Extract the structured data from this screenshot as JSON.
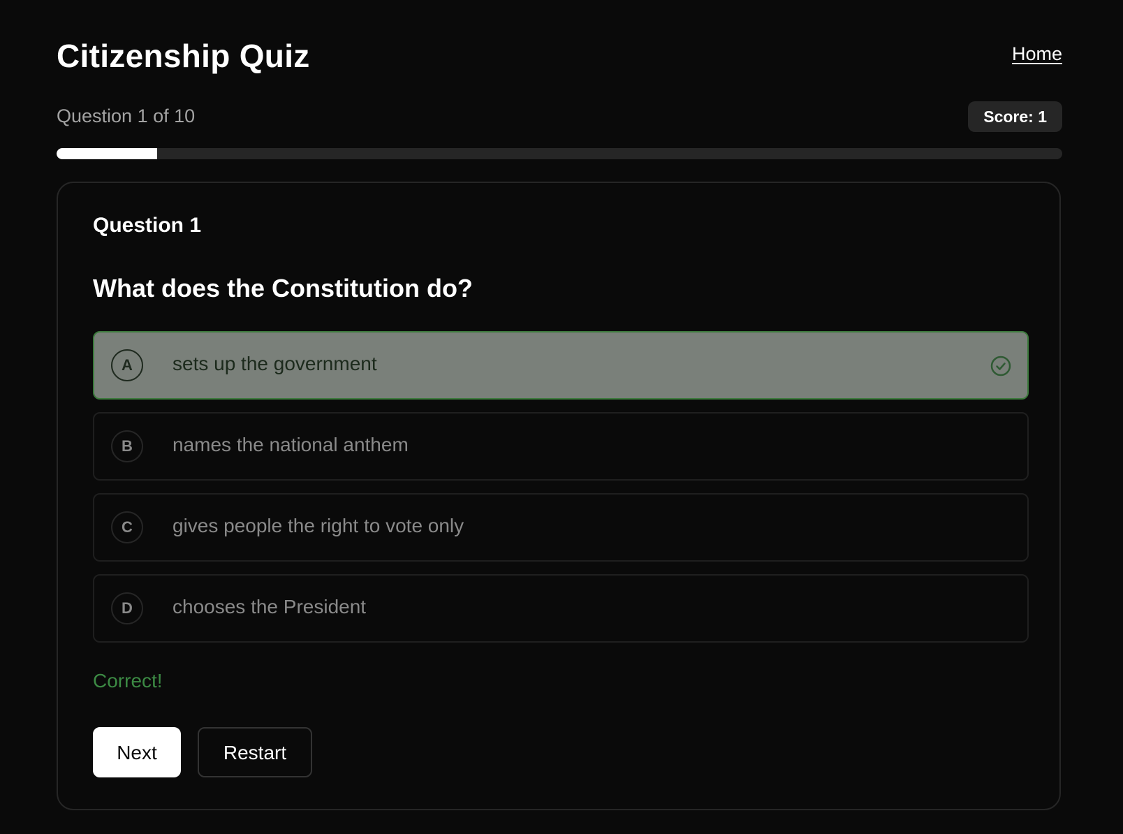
{
  "header": {
    "title": "Citizenship Quiz",
    "home_link": "Home"
  },
  "progress": {
    "label": "Question 1 of 10",
    "current": 1,
    "total": 10,
    "fraction": 0.1,
    "score_label": "Score: 1"
  },
  "question": {
    "number_label": "Question 1",
    "text": "What does the Constitution do?",
    "options": [
      {
        "letter": "A",
        "text": "sets up the government",
        "state": "correct"
      },
      {
        "letter": "B",
        "text": "names the national anthem",
        "state": "neutral"
      },
      {
        "letter": "C",
        "text": "gives people the right to vote only",
        "state": "neutral"
      },
      {
        "letter": "D",
        "text": "chooses the President",
        "state": "neutral"
      }
    ],
    "feedback": "Correct!"
  },
  "actions": {
    "next_label": "Next",
    "restart_label": "Restart"
  },
  "colors": {
    "background": "#0a0a0a",
    "correct_fill": "#7a807a",
    "correct_border": "#3c7a3c",
    "feedback_green": "#3c8a44",
    "badge_bg": "#262626"
  },
  "icons": {
    "selected_check": "check-circle-icon"
  }
}
